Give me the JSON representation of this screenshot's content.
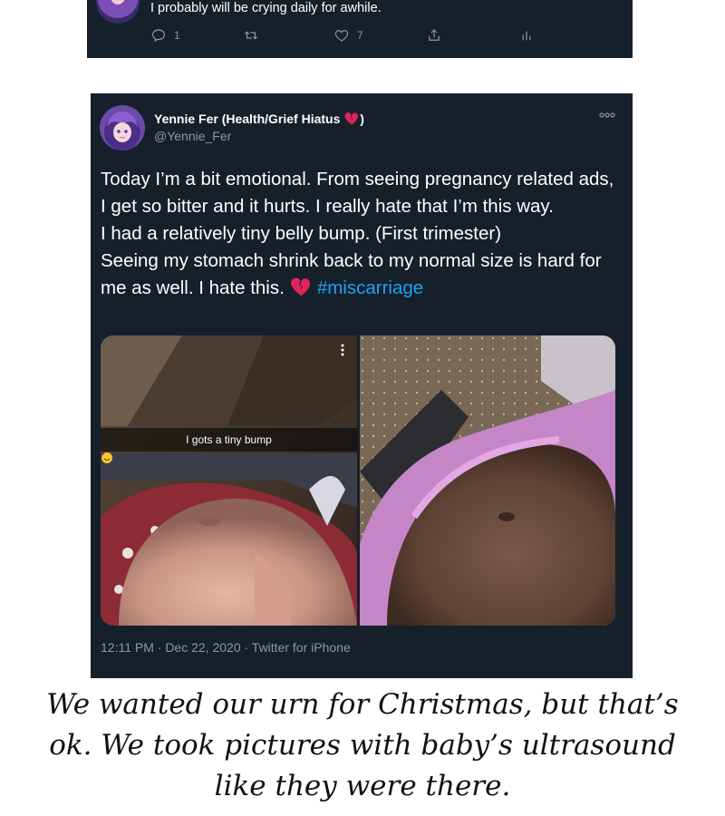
{
  "top_tweet": {
    "text": "I probably will be crying daily for awhile.",
    "reply_count": "1",
    "like_count": "7"
  },
  "tweet": {
    "display_name": "Yennie Fer (Health/Grief Hiatus ",
    "display_name_close": ")",
    "handle": "@Yennie_Fer",
    "paragraphs": [
      "Today I’m a bit emotional. From seeing pregnancy related ads, I get so bitter and it hurts. I really hate that I’m this way.",
      "I had a relatively tiny belly bump. (First trimester)",
      "Seeing my stomach shrink back to my normal size is hard for me as well. I hate this."
    ],
    "hashtag": "#miscarriage",
    "photo_caption": "I gots a tiny bump",
    "meta": "12:11 PM · Dec 22, 2020 · Twitter for iPhone",
    "icons": [
      "broken-heart-emoji",
      "more-options-icon",
      "smiling-hearts-emoji"
    ]
  },
  "caption": "We wanted our urn for Christmas, but that’s ok. We took pictures with baby’s ultrasound like they were there.",
  "colors": {
    "card_bg": "#15202b",
    "muted": "#8899a6",
    "link": "#1da1f2",
    "broken_heart": "#e0245e"
  }
}
